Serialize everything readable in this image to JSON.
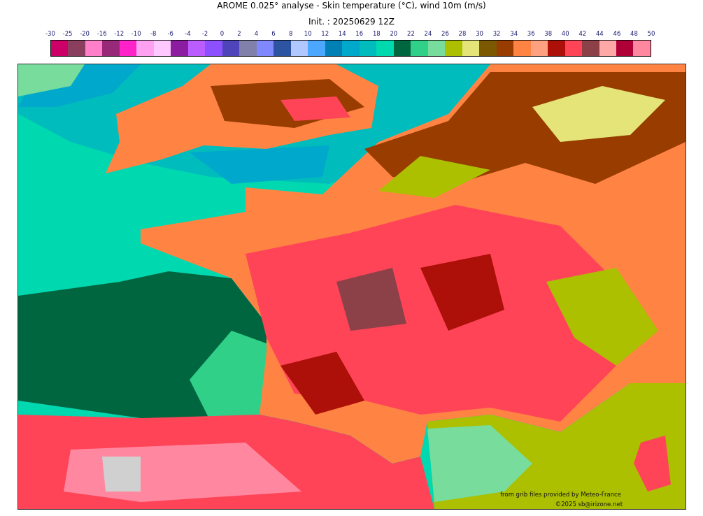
{
  "title": "AROME 0.025° analyse - Skin temperature (°C), wind 10m (m/s)",
  "subtitle": "Init. : 20250629 12Z",
  "colorbar": {
    "labels": [
      "-30",
      "-25",
      "-20",
      "-16",
      "-12",
      "-10",
      "-8",
      "-6",
      "-4",
      "-2",
      "0",
      "2",
      "4",
      "6",
      "8",
      "10",
      "12",
      "14",
      "16",
      "18",
      "20",
      "22",
      "24",
      "26",
      "28",
      "30",
      "32",
      "34",
      "36",
      "38",
      "40",
      "42",
      "44",
      "46",
      "48",
      "50"
    ],
    "swatches": [
      {
        "color": "#cc0066"
      },
      {
        "color": "#8b3f5e"
      },
      {
        "color": "#ff80c8"
      },
      {
        "color": "#982878"
      },
      {
        "color": "#ff22c8"
      },
      {
        "color": "#ffa0f0"
      },
      {
        "color": "#ffc8ff"
      },
      {
        "color": "#8c1ca0"
      },
      {
        "color": "#bb5cff"
      },
      {
        "color": "#8c50ff"
      },
      {
        "color": "#5044bb"
      },
      {
        "color": "#8080aa"
      },
      {
        "color": "#8088ff"
      },
      {
        "color": "#2c54a0"
      },
      {
        "color": "#b0c8ff"
      },
      {
        "color": "#4ca8ff"
      },
      {
        "color": "#0080b4"
      },
      {
        "color": "#00a8cc"
      },
      {
        "color": "#00bcbc"
      },
      {
        "color": "#00d8b0"
      },
      {
        "color": "#006640"
      },
      {
        "color": "#30d088"
      },
      {
        "color": "#78dc9c"
      },
      {
        "color": "#acc000"
      },
      {
        "color": "#e4e478"
      },
      {
        "color": "#7c5800"
      },
      {
        "color": "#983c00"
      },
      {
        "color": "#ff8444"
      },
      {
        "color": "#ffa080"
      },
      {
        "color": "#ac1008"
      },
      {
        "color": "#ff4458"
      },
      {
        "color": "#8c4048"
      },
      {
        "color": "#ffa8a8"
      },
      {
        "color": "#b00038"
      },
      {
        "color": "#ff88a0"
      }
    ]
  },
  "credits": [
    "from grib files provided by Meteo-France",
    "©2025 sb@irizone.net"
  ]
}
